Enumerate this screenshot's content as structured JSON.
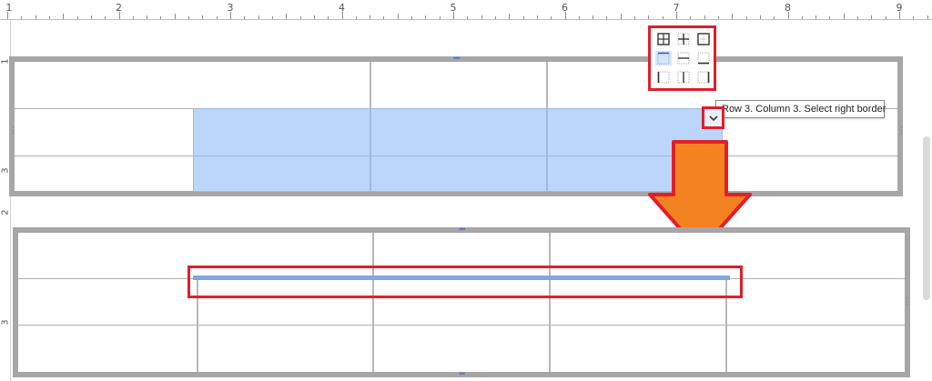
{
  "ruler": {
    "numbers": [
      "1",
      "2",
      "3",
      "4",
      "5",
      "6",
      "7",
      "8",
      "9"
    ],
    "vertical_top": [
      "1",
      "3"
    ],
    "vertical_bottom": [
      "2",
      "3"
    ]
  },
  "tooltip": {
    "text": "Row 3. Column 3. Select right border"
  },
  "border_menu": {
    "buttons": [
      {
        "icon": "all-borders-icon",
        "active": false
      },
      {
        "icon": "inside-borders-icon",
        "active": false
      },
      {
        "icon": "outside-borders-icon",
        "active": false
      },
      {
        "icon": "top-border-icon",
        "active": true
      },
      {
        "icon": "inside-horizontal-border-icon",
        "active": false
      },
      {
        "icon": "bottom-border-icon",
        "active": false
      },
      {
        "icon": "left-border-icon",
        "active": false
      },
      {
        "icon": "inside-vertical-border-icon",
        "active": false
      },
      {
        "icon": "right-border-icon",
        "active": false
      }
    ]
  },
  "annotations": {
    "arrow_color": "#f58220",
    "highlight_color": "#e01f2a",
    "selection_color": "#bcd5fa",
    "new_border_color": "#7ea8de"
  }
}
